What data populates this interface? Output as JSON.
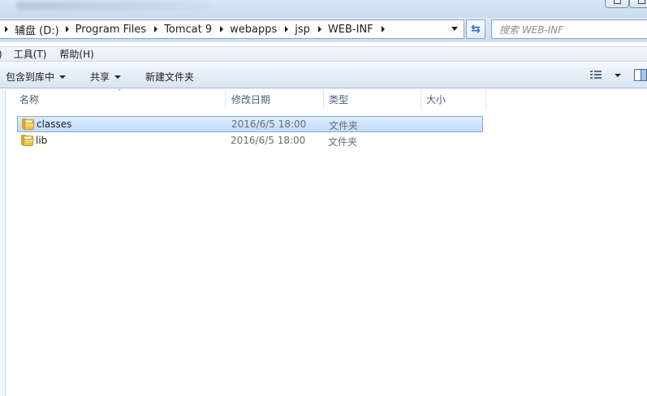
{
  "address_bar": {
    "crumbs": [
      "辅盘 (D:)",
      "Program Files",
      "Tomcat 9",
      "webapps",
      "jsp",
      "WEB-INF"
    ]
  },
  "search": {
    "placeholder": "搜索 WEB-INF"
  },
  "menu": {
    "items": [
      ")",
      "工具(T)",
      "帮助(H)"
    ]
  },
  "commands": {
    "include_library": "包含到库中",
    "share": "共享",
    "new_folder": "新建文件夹"
  },
  "columns": {
    "name": "名称",
    "date_modified": "修改日期",
    "type": "类型",
    "size": "大小"
  },
  "files": [
    {
      "name": "classes",
      "date": "2016/6/5 18:00",
      "type": "文件夹",
      "size": "",
      "selected": true
    },
    {
      "name": "lib",
      "date": "2016/6/5 18:00",
      "type": "文件夹",
      "size": "",
      "selected": false
    }
  ]
}
